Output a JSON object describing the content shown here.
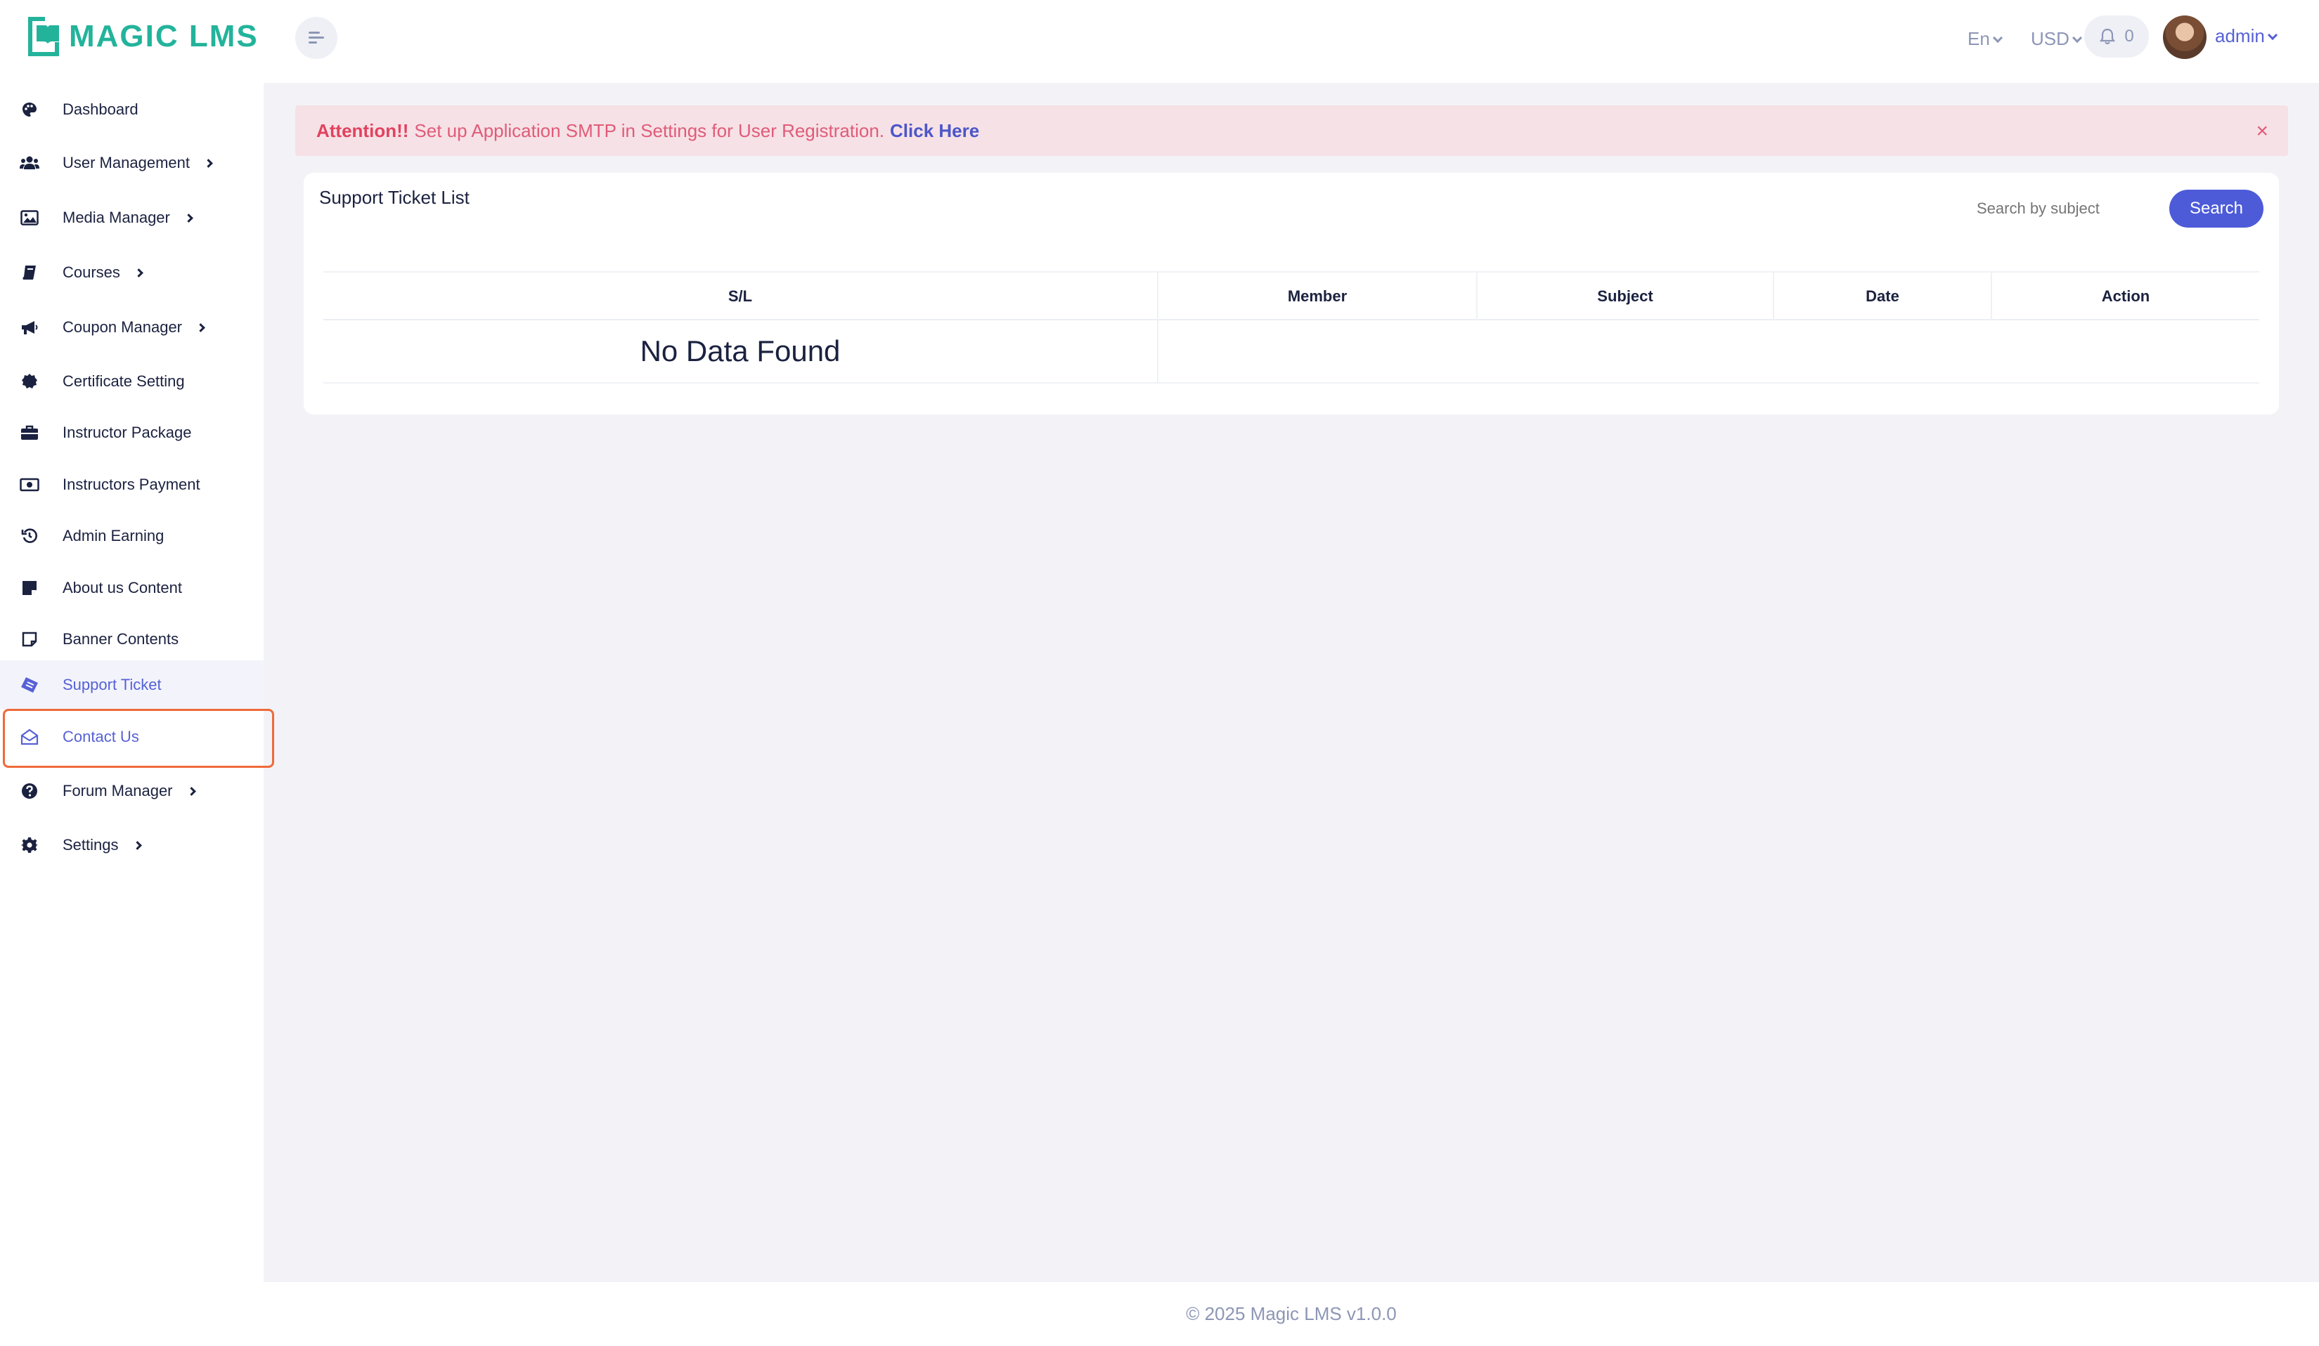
{
  "brand": {
    "name": "MAGIC LMS",
    "primary_color": "#23b39b",
    "accent_color": "#4d5bd8"
  },
  "header": {
    "menu_toggle_icon": "menu-align-icon",
    "language": "En",
    "currency": "USD",
    "notification_count": "0",
    "user_name": "admin"
  },
  "sidebar": {
    "items": [
      {
        "label": "Dashboard",
        "icon": "palette-icon",
        "has_submenu": false
      },
      {
        "label": "User Management",
        "icon": "users-icon",
        "has_submenu": true
      },
      {
        "label": "Media Manager",
        "icon": "image-icon",
        "has_submenu": true
      },
      {
        "label": "Courses",
        "icon": "book-icon",
        "has_submenu": true
      },
      {
        "label": "Coupon Manager",
        "icon": "megaphone-icon",
        "has_submenu": true
      },
      {
        "label": "Certificate Setting",
        "icon": "certificate-icon",
        "has_submenu": false
      },
      {
        "label": "Instructor Package",
        "icon": "briefcase-icon",
        "has_submenu": false
      },
      {
        "label": "Instructors Payment",
        "icon": "money-icon",
        "has_submenu": false
      },
      {
        "label": "Admin Earning",
        "icon": "history-icon",
        "has_submenu": false
      },
      {
        "label": "About us Content",
        "icon": "sticky-note-icon",
        "has_submenu": false
      },
      {
        "label": "Banner Contents",
        "icon": "note-outline-icon",
        "has_submenu": false
      },
      {
        "label": "Support Ticket",
        "icon": "ticket-icon",
        "has_submenu": false,
        "active": true
      },
      {
        "label": "Contact Us",
        "icon": "envelope-open-icon",
        "has_submenu": false
      },
      {
        "label": "Forum Manager",
        "icon": "question-icon",
        "has_submenu": true
      },
      {
        "label": "Settings",
        "icon": "gear-icon",
        "has_submenu": true
      }
    ]
  },
  "alert": {
    "prefix": "Attention!!",
    "message": "Set up Application SMTP in Settings for User Registration.",
    "link": "Click Here",
    "close": "×"
  },
  "ticket_list": {
    "title": "Support Ticket List",
    "search_placeholder": "Search by subject",
    "search_button": "Search",
    "columns": [
      "S/L",
      "Member",
      "Subject",
      "Date",
      "Action"
    ],
    "empty_message": "No Data Found"
  },
  "footer": {
    "text": "© 2025 Magic LMS v1.0.0"
  }
}
